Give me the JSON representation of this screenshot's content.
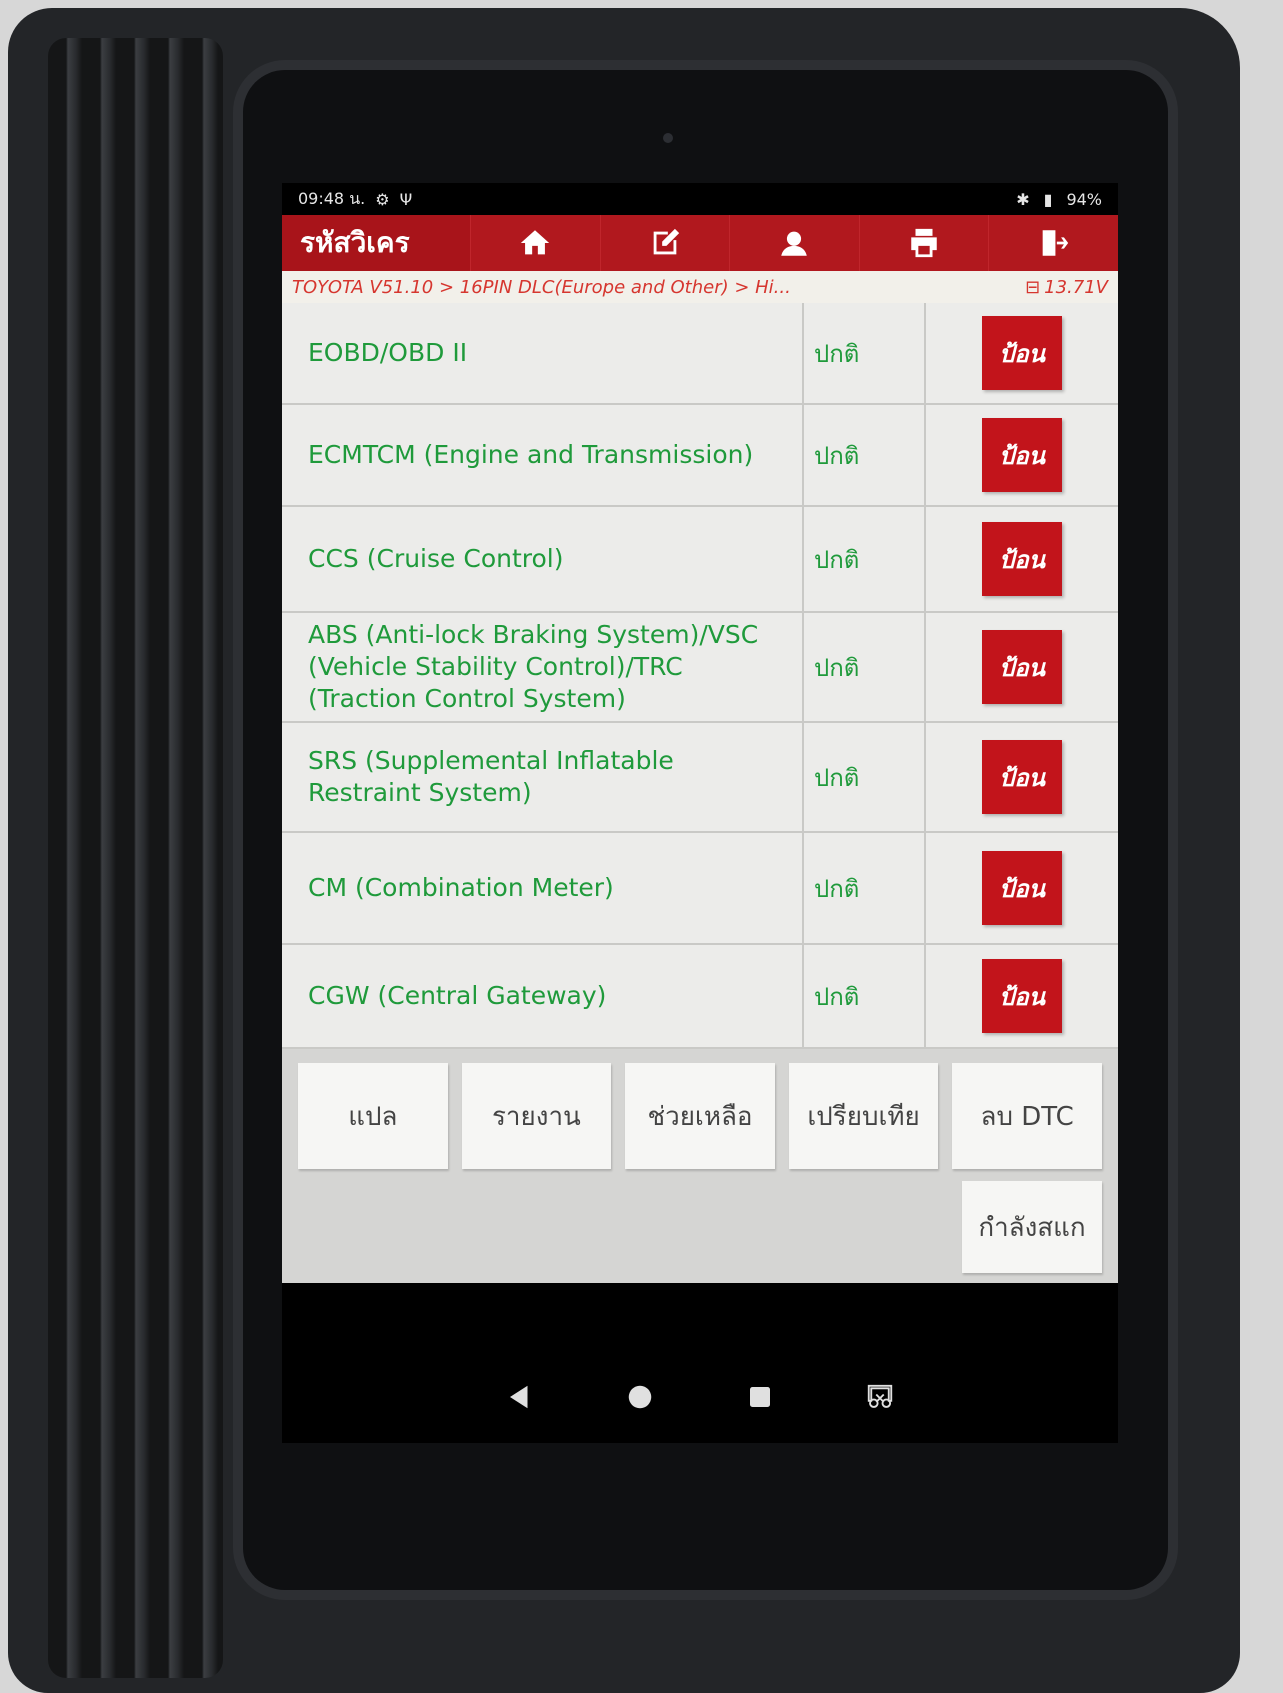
{
  "status_bar": {
    "time": "09:48 น.",
    "battery": "94%"
  },
  "topbar": {
    "title": "รหัสวิเคร",
    "icons": [
      "home-icon",
      "edit-icon",
      "user-icon",
      "print-icon",
      "exit-icon"
    ]
  },
  "breadcrumb": {
    "path": "TOYOTA V51.10 > 16PIN DLC(Europe and Other) > Hi...",
    "voltage": "13.71V"
  },
  "systems": [
    {
      "name": "EOBD/OBD II",
      "status": "ปกติ",
      "action": "ป้อน"
    },
    {
      "name": "ECMTCM (Engine and Transmission)",
      "status": "ปกติ",
      "action": "ป้อน"
    },
    {
      "name": "CCS (Cruise Control)",
      "status": "ปกติ",
      "action": "ป้อน"
    },
    {
      "name": "ABS (Anti-lock Braking System)/VSC (Vehicle Stability Control)/TRC (Traction Control System)",
      "status": "ปกติ",
      "action": "ป้อน"
    },
    {
      "name": "SRS (Supplemental Inflatable Restraint System)",
      "status": "ปกติ",
      "action": "ป้อน"
    },
    {
      "name": "CM (Combination Meter)",
      "status": "ปกติ",
      "action": "ป้อน"
    },
    {
      "name": "CGW (Central Gateway)",
      "status": "ปกติ",
      "action": "ป้อน"
    }
  ],
  "bottom_buttons": {
    "translate": "แปล",
    "report": "รายงาน",
    "help": "ช่วยเหลือ",
    "compare": "เปรียบเทีย",
    "clear_dtc": "ลบ DTC",
    "scanning": "กำลังสแก"
  },
  "colors": {
    "accent_red": "#b1181e",
    "text_green": "#1f9a3b",
    "breadcrumb_red": "#d6362f"
  }
}
